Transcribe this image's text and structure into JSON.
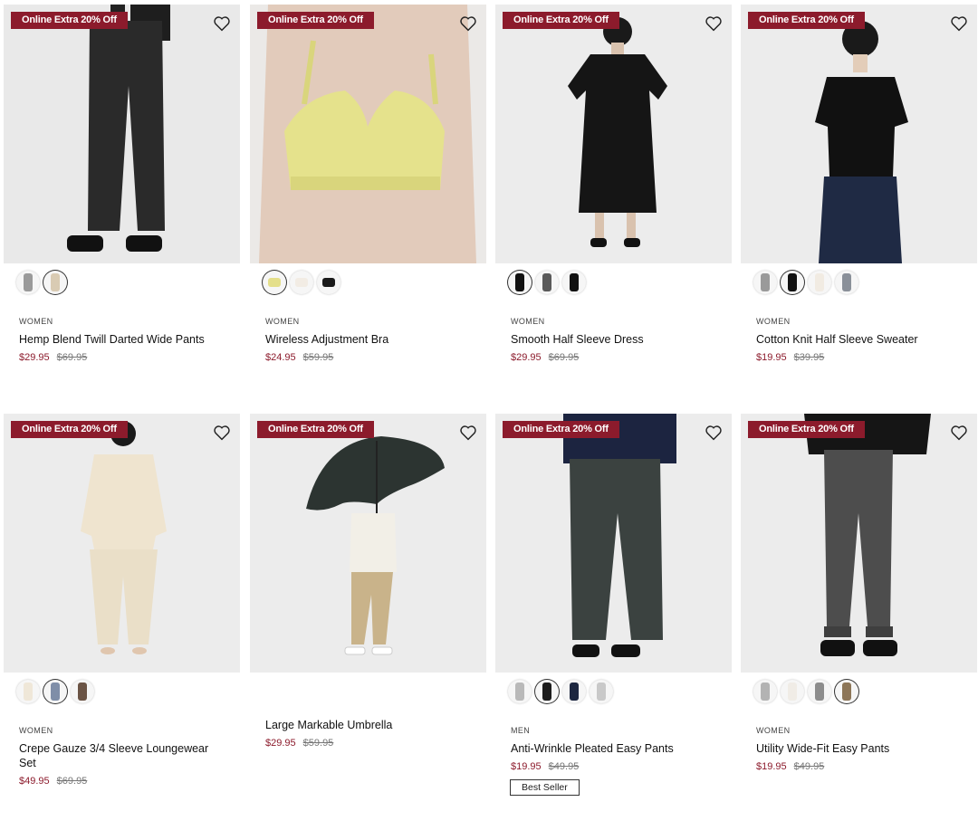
{
  "products": [
    {
      "badge": "Online Extra 20% Off",
      "category": "WOMEN",
      "name": "Hemp Blend Twill Darted Wide Pants",
      "sale": "$29.95",
      "original": "$69.95",
      "swatches": [
        "#9a9a9a",
        "#d9cbb3"
      ],
      "selected": 1
    },
    {
      "badge": "Online Extra 20% Off",
      "category": "WOMEN",
      "name": "Wireless Adjustment Bra",
      "sale": "$24.95",
      "original": "$59.95",
      "swatches": [
        "#e4df8a",
        "#f2ece4",
        "#1a1a1a"
      ],
      "selected": 0
    },
    {
      "badge": "Online Extra 20% Off",
      "category": "WOMEN",
      "name": "Smooth Half Sleeve Dress",
      "sale": "$29.95",
      "original": "$69.95",
      "swatches": [
        "#111111",
        "#5a5a5a",
        "#111111"
      ],
      "selected": 0
    },
    {
      "badge": "Online Extra 20% Off",
      "category": "WOMEN",
      "name": "Cotton Knit Half Sleeve Sweater",
      "sale": "$19.95",
      "original": "$39.95",
      "swatches": [
        "#9a9a9a",
        "#111111",
        "#f1ebe2",
        "#8a9099"
      ],
      "selected": 1
    },
    {
      "badge": "Online Extra 20% Off",
      "category": "WOMEN",
      "name": "Crepe Gauze 3/4 Sleeve Loungewear Set",
      "sale": "$49.95",
      "original": "$69.95",
      "swatches": [
        "#efe7d8",
        "#7f8ea8",
        "#6b5445"
      ],
      "selected": 1
    },
    {
      "badge": "Online Extra 20% Off",
      "category": "",
      "name": "Large Markable Umbrella",
      "sale": "$29.95",
      "original": "$59.95",
      "swatches": [],
      "selected": -1
    },
    {
      "badge": "Online Extra 20% Off",
      "category": "MEN",
      "name": "Anti-Wrinkle Pleated Easy Pants",
      "sale": "$19.95",
      "original": "$49.95",
      "swatches": [
        "#b9b9b9",
        "#1c1c1c",
        "#1d2740",
        "#c9c9c9"
      ],
      "selected": 1,
      "tag": "Best Seller"
    },
    {
      "badge": "Online Extra 20% Off",
      "category": "WOMEN",
      "name": "Utility Wide-Fit Easy Pants",
      "sale": "$19.95",
      "original": "$49.95",
      "swatches": [
        "#b3b3b3",
        "#f0ece6",
        "#8d8d8d",
        "#8d7658"
      ],
      "selected": 3
    }
  ],
  "icons": {
    "favorite": "heart-outline-icon"
  },
  "colors": {
    "badge": "#8c1b2c",
    "sale_price": "#8c1b2c",
    "original_price": "#777777"
  }
}
